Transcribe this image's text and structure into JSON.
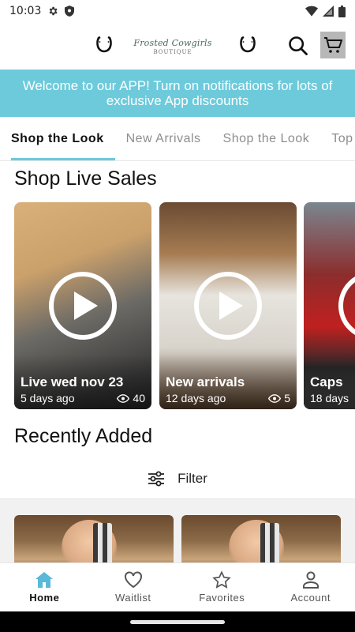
{
  "status_bar": {
    "time": "10:03",
    "icons": [
      "settings-icon",
      "shield-icon",
      "wifi-icon",
      "signal-icon",
      "battery-icon"
    ]
  },
  "header": {
    "logo_main": "Frosted Cowgirls",
    "logo_sub": "BOUTIQUE",
    "icons": [
      "horseshoe-icon",
      "search-icon",
      "cart-icon"
    ]
  },
  "banner": {
    "text": "Welcome to our APP!  Turn on notifications for lots of exclusive App discounts"
  },
  "tabs": [
    {
      "label": "Shop the Look",
      "active": true
    },
    {
      "label": "New Arrivals",
      "active": false
    },
    {
      "label": "Shop the Look",
      "active": false
    },
    {
      "label": "Top",
      "active": false
    }
  ],
  "live_sales": {
    "title": "Shop Live Sales",
    "cards": [
      {
        "title": "Live wed nov 23",
        "age": "5 days ago",
        "views": "40"
      },
      {
        "title": "New arrivals",
        "age": "12 days ago",
        "views": "5"
      },
      {
        "title": "Caps",
        "age": "18 days",
        "views": ""
      }
    ]
  },
  "recent": {
    "title": "Recently Added",
    "filter_label": "Filter"
  },
  "bottom_nav": [
    {
      "label": "Home",
      "icon": "home-icon",
      "active": true
    },
    {
      "label": "Waitlist",
      "icon": "heart-icon",
      "active": false
    },
    {
      "label": "Favorites",
      "icon": "star-icon",
      "active": false
    },
    {
      "label": "Account",
      "icon": "account-icon",
      "active": false
    }
  ],
  "colors": {
    "accent": "#6ccadb",
    "cart_bg": "#b7b7b7",
    "home_icon": "#5ab9d9"
  }
}
